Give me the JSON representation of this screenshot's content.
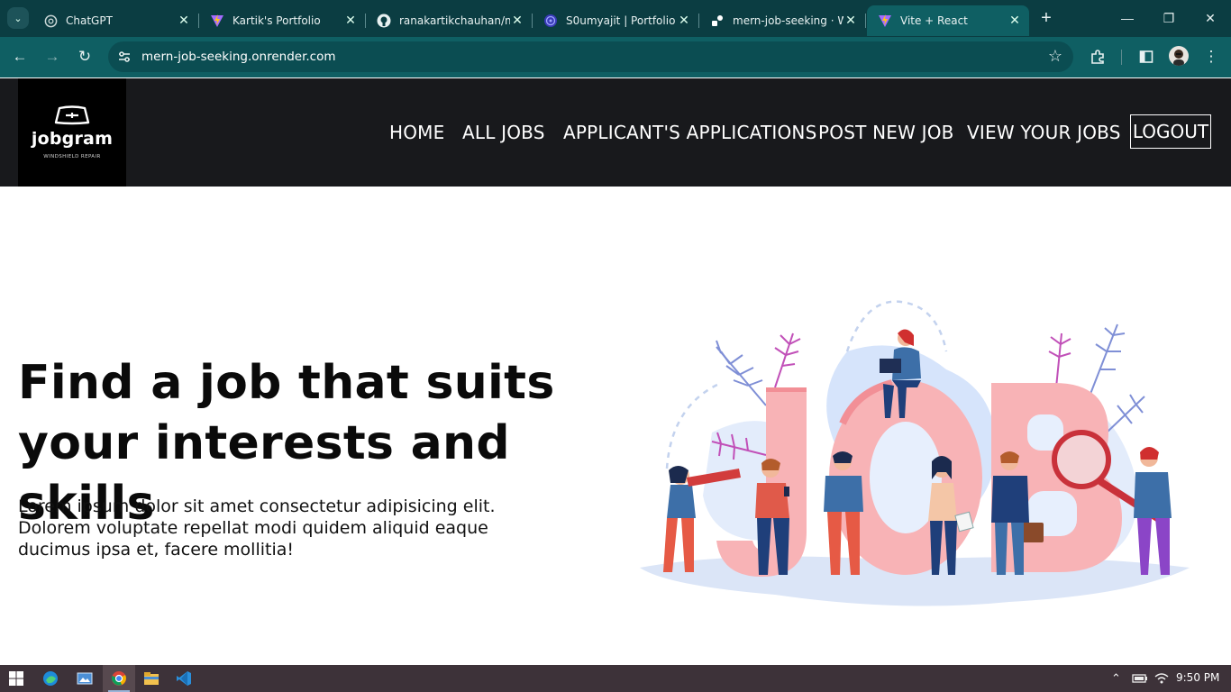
{
  "browser": {
    "tabs": [
      {
        "title": "ChatGPT",
        "icon": "chatgpt-icon"
      },
      {
        "title": "Kartik's Portfolio",
        "icon": "vite-icon"
      },
      {
        "title": "ranakartikchauhan/m",
        "icon": "github-icon"
      },
      {
        "title": "S0umyajit | Portfolio",
        "icon": "portfolio-icon"
      },
      {
        "title": "mern-job-seeking · W",
        "icon": "render-icon"
      },
      {
        "title": "Vite + React",
        "icon": "vite-icon",
        "active": true
      }
    ],
    "url": "mern-job-seeking.onrender.com",
    "theme_color": "#0f5f63"
  },
  "site": {
    "logo": {
      "word": "jobgram",
      "tagline": "WINDSHIELD REPAIR"
    },
    "nav": {
      "home": "HOME",
      "all_jobs": "ALL JOBS",
      "applications": "APPLICANT'S APPLICATIONS",
      "post_job": "POST NEW JOB",
      "view_jobs": "VIEW YOUR JOBS",
      "logout": "LOGOUT"
    },
    "hero": {
      "title": "Find a job that suits your interests and skills",
      "text": "Lorem ipsum dolor sit amet consectetur adipisicing elit. Dolorem voluptate repellat modi quidem aliquid eaque ducimus ipsa et, facere mollitia!"
    },
    "illustration_letters": "JOB"
  },
  "taskbar": {
    "apps": [
      "windows-start-icon",
      "edge-icon",
      "photos-icon",
      "chrome-icon",
      "file-explorer-icon",
      "vscode-icon"
    ],
    "time": "9:50 PM"
  }
}
